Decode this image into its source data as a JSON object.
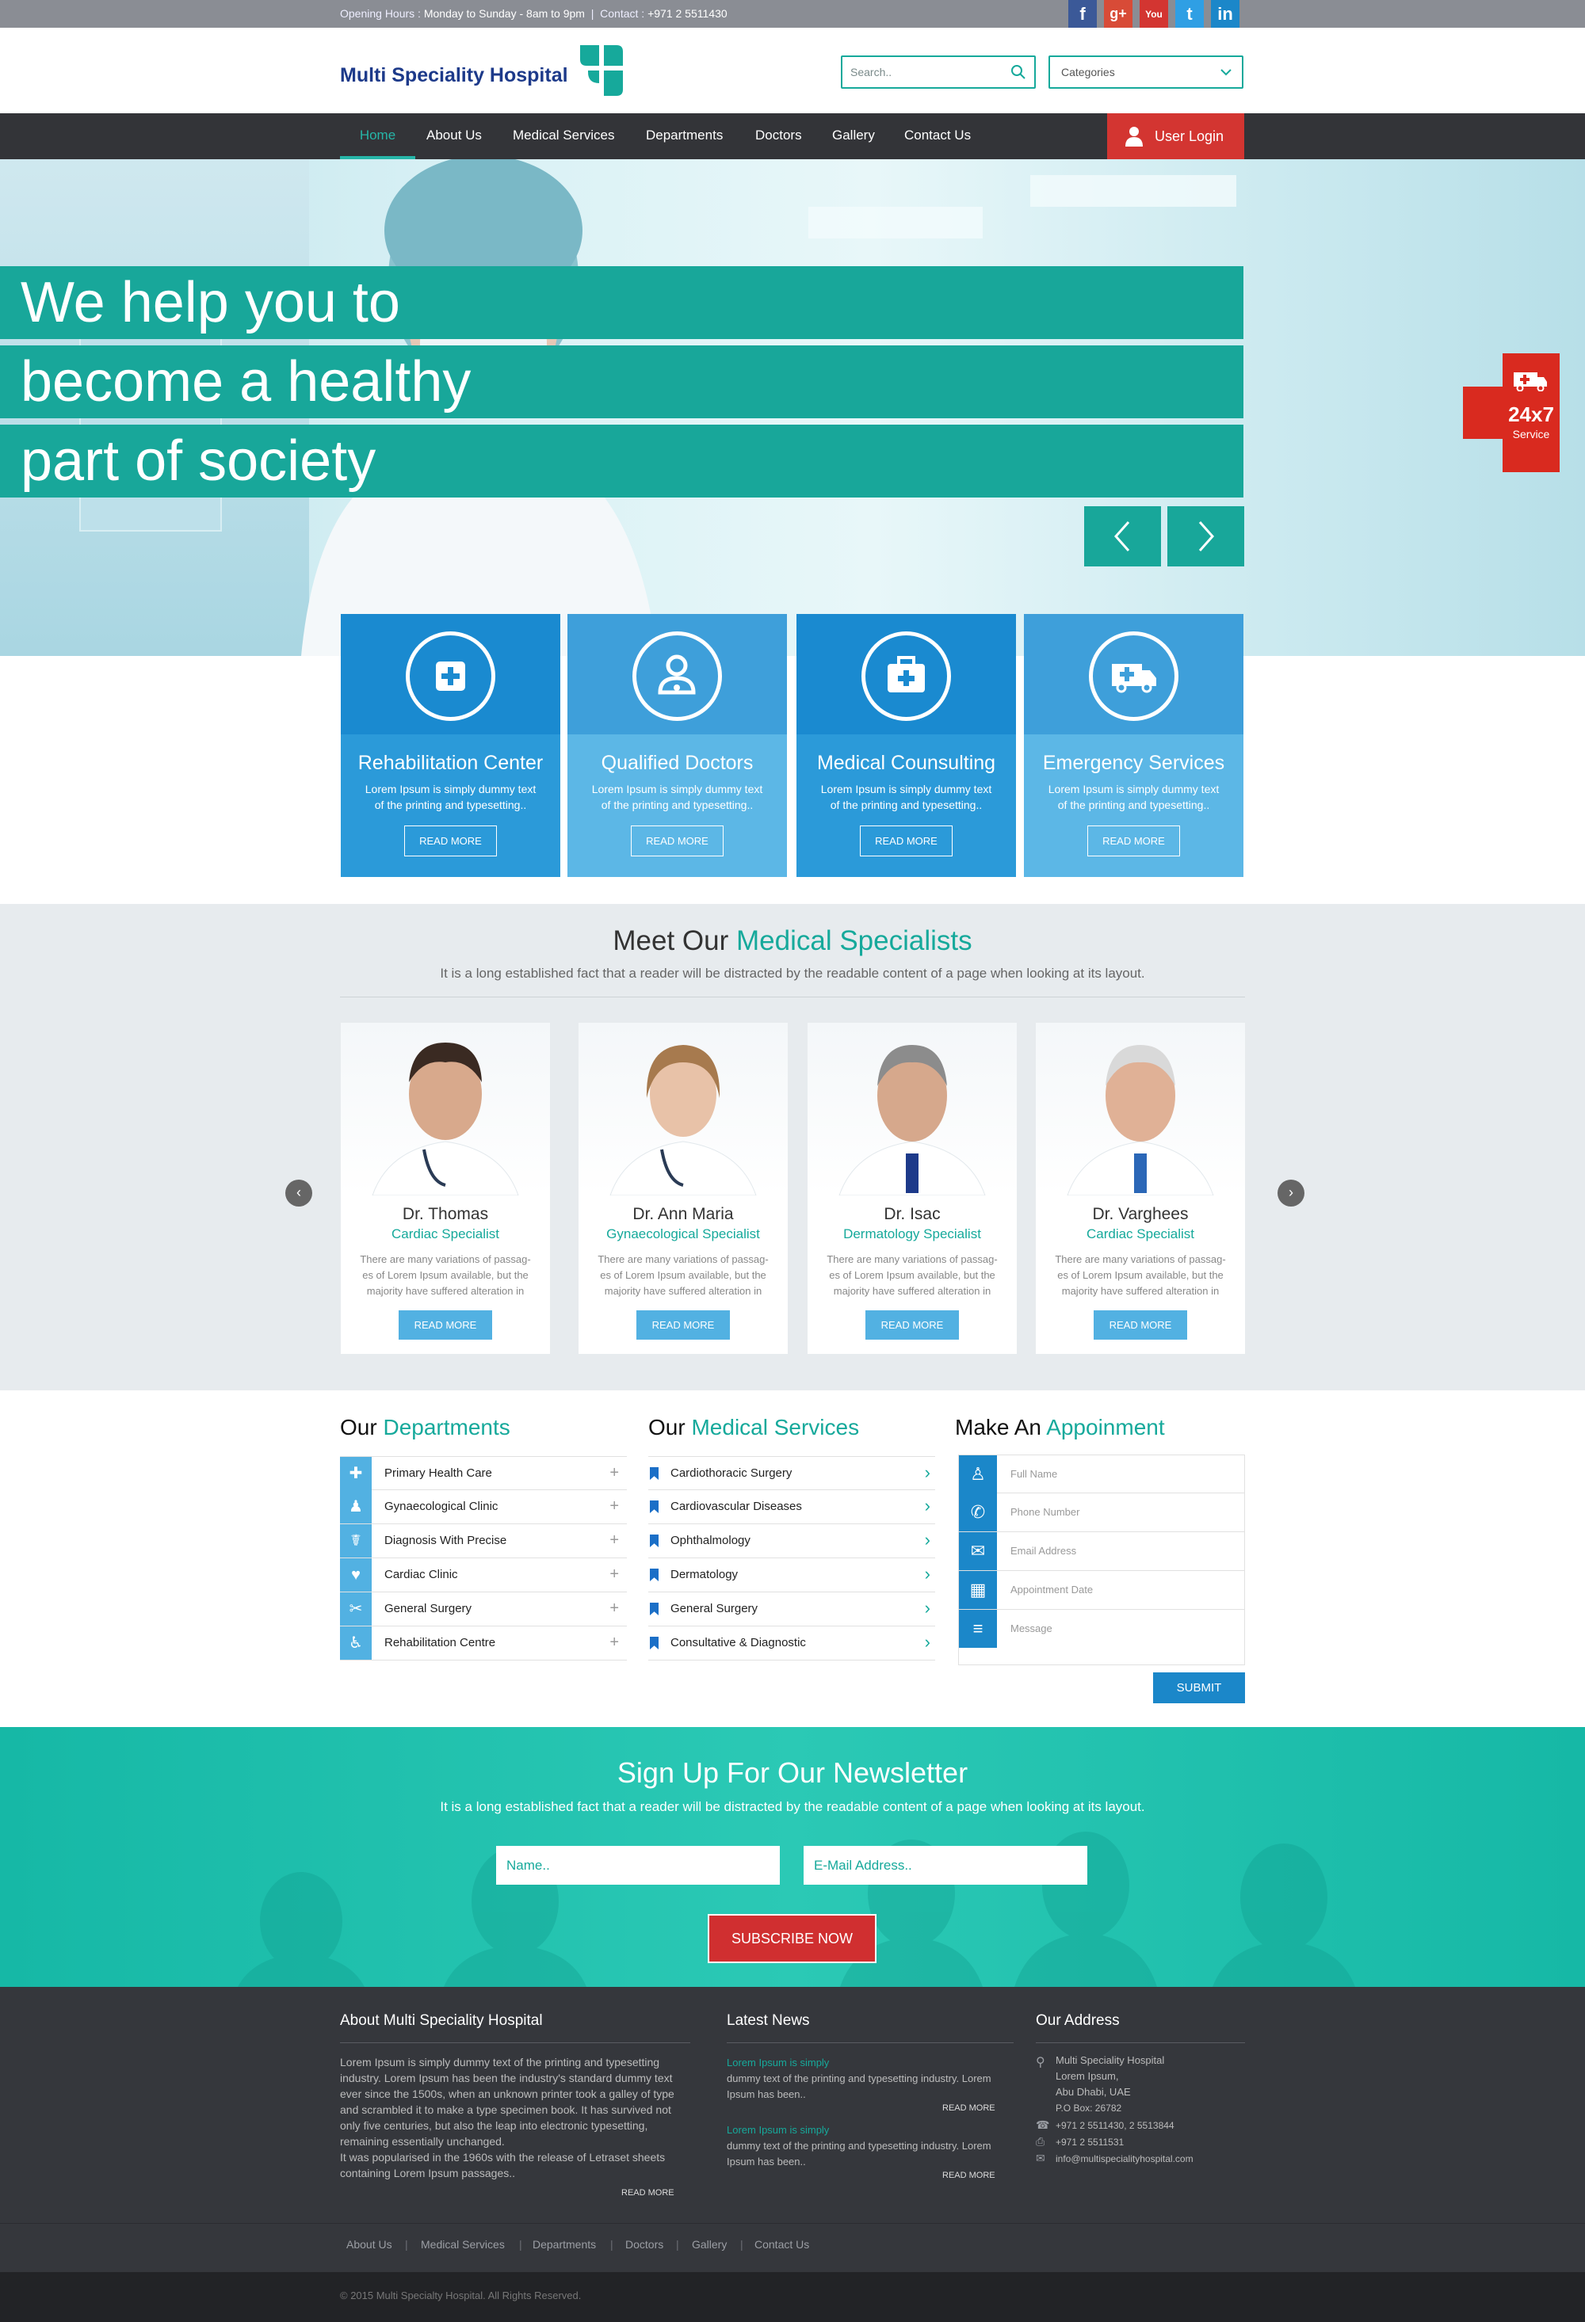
{
  "topbar": {
    "hours_label": "Opening Hours :",
    "hours_value": "Monday to Sunday - 8am to 9pm",
    "contact_label": "Contact :",
    "contact_value": "+971 2 5511430",
    "social": [
      "f",
      "g+",
      "You",
      "t",
      "in"
    ]
  },
  "header": {
    "logo_text": "Multi Speciality Hospital",
    "search_placeholder": "Search..",
    "categories_placeholder": "Categories"
  },
  "nav": {
    "items": [
      "Home",
      "About Us",
      "Medical Services",
      "Departments",
      "Doctors",
      "Gallery",
      "Contact Us"
    ],
    "login": "User Login"
  },
  "hero": {
    "lines": [
      "We help you to",
      "become a healthy",
      "part of society"
    ],
    "badge_top": "24x7",
    "badge_bottom": "Service"
  },
  "features": [
    {
      "title": "Rehabilitation Center",
      "text": "Lorem Ipsum is simply dummy text of the printing and typesetting..",
      "button": "READ MORE",
      "color_top": "#1a8ad0",
      "color_bottom": "#2b9ad9"
    },
    {
      "title": "Qualified Doctors",
      "text": "Lorem Ipsum is simply dummy text of the printing and typesetting..",
      "button": "READ MORE",
      "color_top": "#3e9fda",
      "color_bottom": "#5cb7e6"
    },
    {
      "title": "Medical Counsulting",
      "text": "Lorem Ipsum is simply dummy text of the printing and typesetting..",
      "button": "READ MORE",
      "color_top": "#1a8ad0",
      "color_bottom": "#2b9ad9"
    },
    {
      "title": "Emergency Services",
      "text": "Lorem Ipsum is simply dummy text of the printing and typesetting..",
      "button": "READ MORE",
      "color_top": "#3e9fda",
      "color_bottom": "#5cb7e6"
    }
  ],
  "specialists": {
    "title_plain": "Meet Our",
    "title_accent": "Medical Specialists",
    "subtitle": "It is a long established fact that a reader will be distracted by the readable content of a page when looking at its layout.",
    "doctors": [
      {
        "name": "Dr. Thomas",
        "role": "Cardiac Specialist",
        "text": "There are many variations of passag-es of Lorem Ipsum available, but the majority have suffered alteration in",
        "button": "READ MORE"
      },
      {
        "name": "Dr. Ann Maria",
        "role": "Gynaecological Specialist",
        "text": "There are many variations of passag-es of Lorem Ipsum available, but the majority have suffered alteration in",
        "button": "READ MORE"
      },
      {
        "name": "Dr. Isac",
        "role": "Dermatology Specialist",
        "text": "There are many variations of passag-es of Lorem Ipsum available, but the majority have suffered alteration in",
        "button": "READ MORE"
      },
      {
        "name": "Dr. Varghees",
        "role": "Cardiac Specialist",
        "text": "There are many variations of passag-es of Lorem Ipsum available, but the majority have suffered alteration in",
        "button": "READ MORE"
      }
    ]
  },
  "departments": {
    "title_plain": "Our",
    "title_accent": "Departments",
    "items": [
      "Primary Health Care",
      "Gynaecological Clinic",
      "Diagnosis With Precise",
      "Cardiac Clinic",
      "General Surgery",
      "Rehabilitation Centre"
    ]
  },
  "services": {
    "title_plain": "Our",
    "title_accent": "Medical Services",
    "items": [
      "Cardiothoracic Surgery",
      "Cardiovascular Diseases",
      "Ophthalmology",
      "Dermatology",
      "General Surgery",
      "Consultative & Diagnostic"
    ]
  },
  "appointment": {
    "title_plain": "Make An",
    "title_accent": "Appoinment",
    "fields": [
      "Full Name",
      "Phone Number",
      "Email Address",
      "Appointment Date",
      "Message"
    ],
    "submit": "SUBMIT"
  },
  "newsletter": {
    "title": "Sign Up For Our Newsletter",
    "subtitle": "It is a long established fact that a reader will be distracted by the readable content of a page when looking at its layout.",
    "name_placeholder": "Name..",
    "email_placeholder": "E-Mail Address..",
    "button": "SUBSCRIBE NOW"
  },
  "footer": {
    "about_title": "About Multi Speciality Hospital",
    "about_text": "Lorem Ipsum is simply dummy text of the printing and typesetting industry. Lorem Ipsum has been the industry's standard dummy text ever since the 1500s, when an unknown printer took a galley of type and scrambled it to make a type specimen book. It has survived not only five centuries, but also the leap into electronic typesetting, remaining essentially unchanged.",
    "about_text2": "It was popularised in the 1960s with the release of Letraset sheets containing Lorem Ipsum passages..",
    "about_more": "READ MORE",
    "news_title": "Latest News",
    "news": [
      {
        "link": "Lorem Ipsum is simply",
        "text": "dummy text of the printing and typesetting industry. Lorem Ipsum has been..",
        "more": "READ MORE"
      },
      {
        "link": "Lorem Ipsum is simply",
        "text": " dummy text of the printing and typesetting industry. Lorem Ipsum has been..",
        "more": "READ MORE"
      }
    ],
    "address_title": "Our Address",
    "address": [
      "Multi Speciality Hospital",
      "Lorem Ipsum,",
      "Abu Dhabi, UAE",
      "P.O Box: 26782"
    ],
    "phone": "+971 2 5511430, 2 5513844",
    "fax": "+971 2 5511531",
    "email": "info@multispecialityhospital.com",
    "links": [
      "About Us",
      "Medical Services",
      "Departments",
      "Doctors",
      "Gallery",
      "Contact Us"
    ],
    "copyright": "© 2015 Multi Specialty Hospital.  All Rights Reserved."
  }
}
